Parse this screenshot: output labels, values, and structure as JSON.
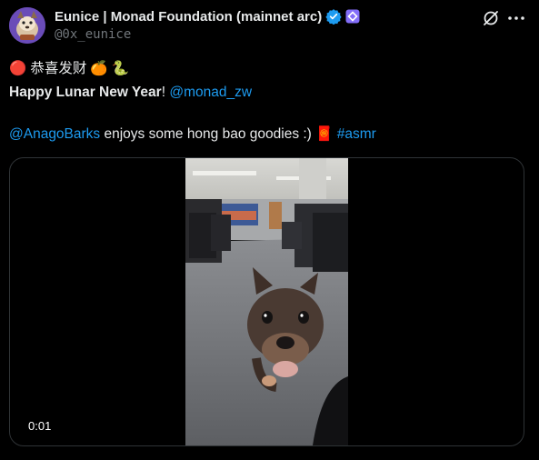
{
  "author": {
    "display_name": "Eunice | Monad Foundation (mainnet arc)",
    "handle": "@0x_eunice",
    "verified_color": "#1d9bf0",
    "affiliate_color": "#836ef9"
  },
  "tweet": {
    "line1": {
      "emoji_lantern": "🔴",
      "chinese": "恭喜发财",
      "emoji_orange": "🍊",
      "emoji_snake": "🐍"
    },
    "line2": {
      "bold_text": "Happy Lunar New Year",
      "punct": "!",
      "mention": "@monad_zw"
    },
    "line3": {
      "mention": "@AnagoBarks",
      "text": " enjoys some hong bao goodies :) ",
      "emoji_envelope": "🧧",
      "hashtag": "#asmr"
    }
  },
  "video": {
    "timestamp": "0:01"
  },
  "icons": {
    "grok": "grok-icon",
    "more": "more-icon"
  },
  "colors": {
    "background": "#000000",
    "text": "#e7e9ea",
    "secondary": "#71767b",
    "link": "#1d9bf0",
    "border": "#2f3336"
  }
}
